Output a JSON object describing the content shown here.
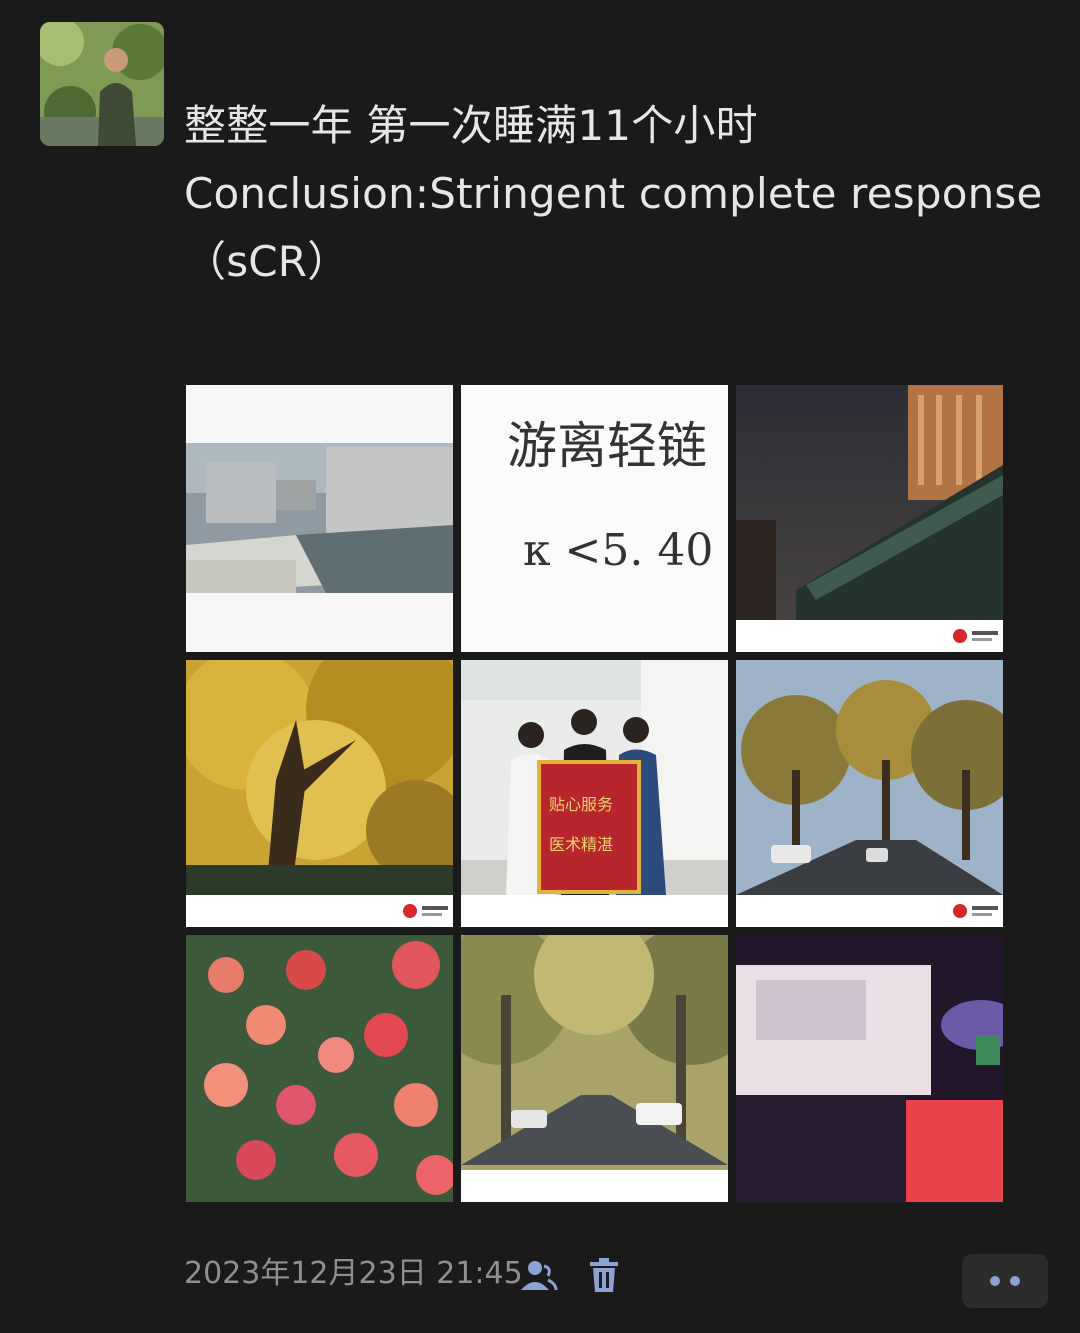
{
  "post": {
    "text_line1": "整整一年 第一次睡满11个小时",
    "text_line2": "Conclusion:Stringent complete response",
    "text_line3": "（sCR）"
  },
  "photos": [
    {
      "name": "photo-river-buildings",
      "description_icon": "image-icon"
    },
    {
      "name": "photo-lab-result",
      "title": "游离轻链",
      "value": "κ <5. 40"
    },
    {
      "name": "photo-night-building",
      "description_icon": "image-icon"
    },
    {
      "name": "photo-ginkgo-tree",
      "description_icon": "image-icon"
    },
    {
      "name": "photo-banner-group",
      "banner_left": "贴心服务",
      "banner_right": "医术精湛"
    },
    {
      "name": "photo-street-trees",
      "description_icon": "image-icon"
    },
    {
      "name": "photo-roses",
      "description_icon": "image-icon"
    },
    {
      "name": "photo-tree-avenue",
      "description_icon": "image-icon"
    },
    {
      "name": "photo-blurred-object",
      "description_icon": "image-icon"
    }
  ],
  "footer": {
    "timestamp": "2023年12月23日 21:45",
    "visibility_icon": "person-icon",
    "delete_icon": "trash-icon",
    "more_icon": "more-dots-icon"
  },
  "colors": {
    "background": "#1a1a1a",
    "text": "#e6e6e6",
    "muted": "#8f8f8f",
    "accent": "#8da2d4"
  }
}
